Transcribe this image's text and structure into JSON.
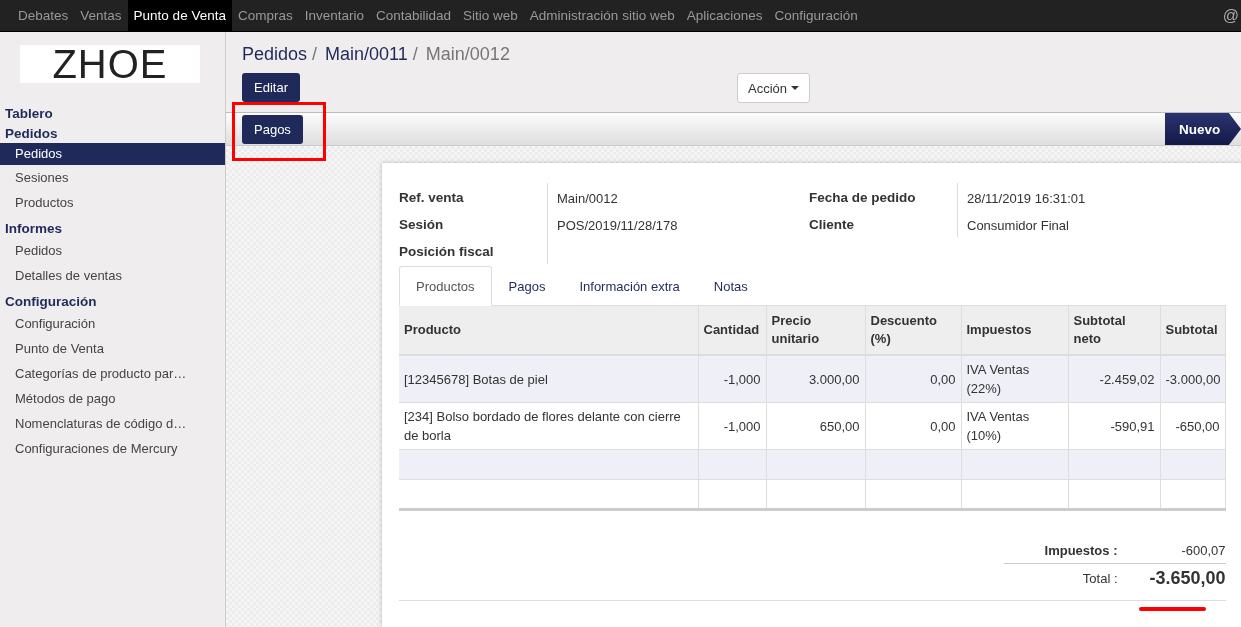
{
  "top_menu": [
    {
      "label": "Debates",
      "selected": false
    },
    {
      "label": "Ventas",
      "selected": false
    },
    {
      "label": "Punto de Venta",
      "selected": true
    },
    {
      "label": "Compras",
      "selected": false
    },
    {
      "label": "Inventario",
      "selected": false
    },
    {
      "label": "Contabilidad",
      "selected": false
    },
    {
      "label": "Sitio web",
      "selected": false
    },
    {
      "label": "Administración sitio web",
      "selected": false
    },
    {
      "label": "Aplicaciones",
      "selected": false
    },
    {
      "label": "Configuración",
      "selected": false
    }
  ],
  "top_right_icon": "@",
  "logo": "ZHOE",
  "sidebar": [
    {
      "title": "Tablero"
    },
    {
      "title": "Pedidos",
      "items": [
        {
          "label": "Pedidos",
          "selected": true
        },
        {
          "label": "Sesiones",
          "selected": false
        },
        {
          "label": "Productos",
          "selected": false
        }
      ]
    },
    {
      "title": "Informes",
      "items": [
        {
          "label": "Pedidos",
          "selected": false
        },
        {
          "label": "Detalles de ventas",
          "selected": false
        }
      ]
    },
    {
      "title": "Configuración",
      "items": [
        {
          "label": "Configuración",
          "selected": false
        },
        {
          "label": "Punto de Venta",
          "selected": false
        },
        {
          "label": "Categorías de producto par…",
          "selected": false
        },
        {
          "label": "Métodos de pago",
          "selected": false
        },
        {
          "label": "Nomenclaturas de código d…",
          "selected": false
        },
        {
          "label": "Configuraciones de Mercury",
          "selected": false
        }
      ]
    }
  ],
  "breadcrumbs": [
    {
      "label": "Pedidos",
      "current": false,
      "separator": "/"
    },
    {
      "label": "Main/0011",
      "current": false,
      "separator": "/"
    },
    {
      "label": "Main/0012",
      "current": true
    }
  ],
  "edit_button": "Editar",
  "action_button": "Acción",
  "payments_button": "Pagos",
  "status": "Nuevo",
  "fields_left": [
    {
      "label": "Ref. venta",
      "value": "Main/0012"
    },
    {
      "label": "Sesión",
      "value": "POS/2019/11/28/178"
    },
    {
      "label": "Posición fiscal"
    }
  ],
  "fields_right": [
    {
      "label": "Fecha de pedido",
      "value": "28/11/2019 16:31:01"
    },
    {
      "label": "Cliente",
      "value": "Consumidor Final"
    }
  ],
  "tabs": [
    {
      "label": "Productos",
      "selected": true
    },
    {
      "label": "Pagos",
      "selected": false
    },
    {
      "label": "Información extra",
      "selected": false
    },
    {
      "label": "Notas",
      "selected": false
    }
  ],
  "table": {
    "columns": [
      "Producto",
      "Cantidad",
      "Precio unitario",
      "Descuento (%)",
      "Impuestos",
      "Subtotal neto",
      "Subtotal"
    ],
    "rows": [
      [
        "[12345678] Botas de piel",
        "-1,000",
        "3.000,00",
        "0,00",
        "IVA Ventas (22%)",
        "-2.459,02",
        "-3.000,00"
      ],
      [
        "[234] Bolso bordado de flores delante con cierre de borla",
        "-1,000",
        "650,00",
        "0,00",
        "IVA Ventas (10%)",
        "-590,91",
        "-650,00"
      ]
    ]
  },
  "totals": {
    "tax_label": "Impuestos :",
    "tax_value": "-600,07",
    "total_label": "Total :",
    "total_value": "-3.650,00"
  }
}
